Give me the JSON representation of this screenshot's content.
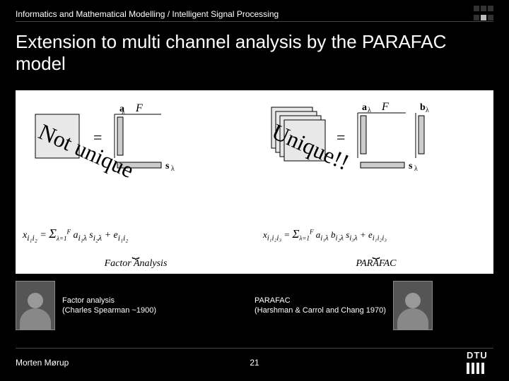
{
  "header": {
    "breadcrumb": "Informatics and Mathematical Modelling / Intelligent Signal Processing"
  },
  "title": "Extension to multi channel analysis by the PARAFAC model",
  "left": {
    "overlay": "Not unique",
    "F": "F",
    "a": "a",
    "sum": "=",
    "s": "s",
    "lam": "λ",
    "eq": "x_{i₁i₂} = Σ_{λ=1}^{F} a_{i₁λ} s_{i₂λ} + e_{i₁i₂}",
    "brace": "Factor Analysis",
    "cap_line1": "Factor analysis",
    "cap_line2": "(Charles Spearman ~1900)"
  },
  "right": {
    "overlay": "Unique!!",
    "F": "F",
    "a": "a",
    "b": "b",
    "sum": "=",
    "s": "s",
    "lam": "λ",
    "eq": "x_{i₁i₂i₃} = Σ_{λ=1}^{F} a_{i₁λ} b_{i₂λ} s_{i₃λ} + e_{i₁i₂i₃}",
    "brace": "PARAFAC",
    "cap_line1": "PARAFAC",
    "cap_line2": "(Harshman & Carrol and Chang 1970)"
  },
  "footer": {
    "author": "Morten Mørup",
    "page": "21",
    "org": "DTU"
  }
}
